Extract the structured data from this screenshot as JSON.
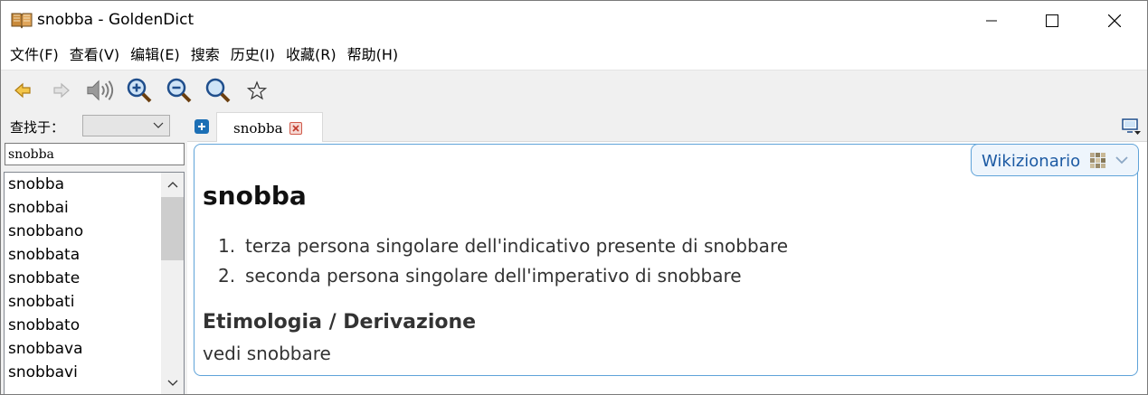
{
  "window": {
    "title": "snobba - GoldenDict",
    "app_icon": "book-icon"
  },
  "menu": {
    "items": [
      "文件(F)",
      "查看(V)",
      "编辑(E)",
      "搜索",
      "历史(I)",
      "收藏(R)",
      "帮助(H)"
    ]
  },
  "toolbar": {
    "buttons": [
      "back-arrow-icon",
      "forward-arrow-icon",
      "speaker-icon",
      "zoom-in-icon",
      "zoom-out-icon",
      "zoom-reset-icon",
      "star-icon"
    ]
  },
  "sidebar": {
    "lookin_label": "查找于：",
    "lookin_value": "",
    "search_value": "snobba",
    "words": [
      "snobba",
      "snobbai",
      "snobbano",
      "snobbata",
      "snobbate",
      "snobbati",
      "snobbato",
      "snobbava",
      "snobbavi"
    ]
  },
  "tabs": [
    {
      "label": "snobba"
    }
  ],
  "article": {
    "dictionary": "Wikizionario",
    "headword": "snobba",
    "definitions": [
      {
        "num": "1.",
        "text": "terza persona singolare dell'indicativo presente di snobbare"
      },
      {
        "num": "2.",
        "text": "seconda persona singolare dell'imperativo di snobbare"
      }
    ],
    "section_title": "Etimologia / Derivazione",
    "section_body": "vedi snobbare"
  },
  "colors": {
    "accent": "#1c5aa3",
    "border": "#5fa3d9",
    "tab_close": "#d05a4a"
  }
}
